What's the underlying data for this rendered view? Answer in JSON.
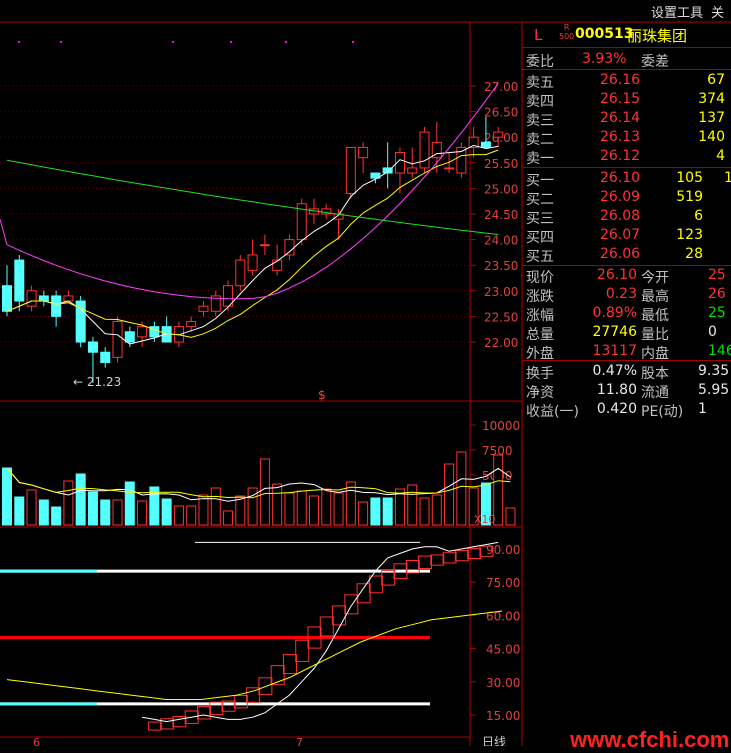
{
  "menu": {
    "settings": "设置工具",
    "more": "关"
  },
  "stock": {
    "market": "L",
    "badge_top": "R",
    "badge_bottom": "500",
    "code": "000513",
    "name": "丽珠集团"
  },
  "quote": {
    "weibi_label": "委比",
    "weibi": "3.93%",
    "weicha_label": "委差",
    "asks": [
      {
        "label": "卖五",
        "price": "26.16",
        "vol": "67"
      },
      {
        "label": "卖四",
        "price": "26.15",
        "vol": "374"
      },
      {
        "label": "卖三",
        "price": "26.14",
        "vol": "137"
      },
      {
        "label": "卖二",
        "price": "26.13",
        "vol": "140"
      },
      {
        "label": "卖一",
        "price": "26.12",
        "vol": "4"
      }
    ],
    "bids": [
      {
        "label": "买一",
        "price": "26.10",
        "vol": "105",
        "extra": "1"
      },
      {
        "label": "买二",
        "price": "26.09",
        "vol": "519"
      },
      {
        "label": "买三",
        "price": "26.08",
        "vol": "6"
      },
      {
        "label": "买四",
        "price": "26.07",
        "vol": "123"
      },
      {
        "label": "买五",
        "price": "26.06",
        "vol": "28"
      }
    ],
    "stats": [
      {
        "l1": "现价",
        "v1": "26.10",
        "l2": "今开",
        "v2": "25"
      },
      {
        "l1": "涨跌",
        "v1": "0.23",
        "l2": "最高",
        "v2": "26"
      },
      {
        "l1": "涨幅",
        "v1": "0.89%",
        "l2": "最低",
        "v2": "25"
      },
      {
        "l1": "总量",
        "v1": "27746",
        "l2": "量比",
        "v2": "0"
      },
      {
        "l1": "外盘",
        "v1": "13117",
        "l2": "内盘",
        "v2": "146"
      }
    ],
    "fund": [
      {
        "l1": "换手",
        "v1": "0.47%",
        "l2": "股本",
        "v2": "9.35"
      },
      {
        "l1": "净资",
        "v1": "11.80",
        "l2": "流通",
        "v2": "5.95"
      },
      {
        "l1": "收益(一)",
        "v1": "0.420",
        "l2": "PE(动)",
        "v2": "1"
      }
    ]
  },
  "chart_data": [
    {
      "type": "candlestick",
      "yaxis_ticks": [
        "27.00",
        "26.50",
        "26.00",
        "25.50",
        "25.00",
        "24.50",
        "24.00",
        "23.50",
        "23.00",
        "22.50",
        "22.00"
      ],
      "ylim": [
        21.0,
        27.5
      ],
      "annotation": "21.23",
      "marker": "$",
      "candles": [
        [
          23.1,
          23.5,
          22.5,
          22.6
        ],
        [
          23.6,
          23.7,
          22.6,
          22.8
        ],
        [
          22.7,
          23.1,
          22.6,
          23.0
        ],
        [
          22.9,
          23.0,
          22.7,
          22.8
        ],
        [
          22.9,
          23.0,
          22.3,
          22.5
        ],
        [
          22.8,
          23.0,
          22.9,
          22.9
        ],
        [
          22.8,
          22.9,
          21.9,
          22.0
        ],
        [
          22.0,
          22.1,
          21.2,
          21.8
        ],
        [
          21.8,
          21.9,
          21.5,
          21.6
        ],
        [
          21.7,
          22.5,
          21.6,
          22.4
        ],
        [
          22.2,
          22.3,
          21.9,
          22.0
        ],
        [
          22.1,
          22.4,
          21.9,
          22.3
        ],
        [
          22.3,
          22.4,
          22.0,
          22.1
        ],
        [
          22.3,
          22.5,
          22.0,
          22.0
        ],
        [
          22.0,
          22.4,
          21.9,
          22.3
        ],
        [
          22.3,
          22.5,
          22.2,
          22.4
        ],
        [
          22.6,
          22.8,
          22.5,
          22.7
        ],
        [
          22.6,
          23.0,
          22.5,
          22.9
        ],
        [
          22.7,
          23.2,
          22.6,
          23.1
        ],
        [
          23.1,
          23.7,
          23.0,
          23.6
        ],
        [
          23.4,
          24.0,
          23.3,
          23.7
        ],
        [
          23.9,
          24.1,
          23.7,
          23.9
        ],
        [
          23.4,
          23.9,
          23.3,
          23.6
        ],
        [
          23.7,
          24.1,
          23.6,
          24.0
        ],
        [
          24.0,
          24.8,
          23.9,
          24.7
        ],
        [
          24.5,
          24.8,
          24.3,
          24.6
        ],
        [
          24.5,
          24.7,
          24.4,
          24.6
        ],
        [
          24.4,
          24.6,
          24.0,
          24.5
        ],
        [
          24.9,
          25.8,
          24.8,
          25.8
        ],
        [
          25.6,
          25.9,
          25.3,
          25.8
        ],
        [
          25.3,
          25.3,
          25.1,
          25.2
        ],
        [
          25.4,
          25.9,
          25.0,
          25.3
        ],
        [
          25.3,
          25.8,
          24.9,
          25.7
        ],
        [
          25.3,
          25.8,
          25.2,
          25.4
        ],
        [
          25.4,
          26.2,
          25.3,
          26.1
        ],
        [
          25.6,
          26.3,
          25.3,
          25.9
        ],
        [
          25.4,
          25.7,
          25.3,
          25.4
        ],
        [
          25.3,
          25.9,
          25.2,
          25.8
        ],
        [
          25.8,
          26.2,
          25.6,
          26.0
        ],
        [
          25.9,
          26.4,
          25.8,
          25.8
        ],
        [
          26.0,
          26.2,
          25.8,
          26.1
        ]
      ]
    },
    {
      "type": "bar",
      "series_name": "volume",
      "axis_unit": "X10",
      "yaxis_ticks": [
        "10000",
        "7500",
        "5000"
      ],
      "ylim": [
        0,
        10500
      ],
      "values": [
        5700,
        2800,
        3500,
        2500,
        1800,
        4400,
        5100,
        3300,
        2500,
        2500,
        4300,
        2400,
        3800,
        2600,
        1900,
        1900,
        3000,
        3700,
        1400,
        2900,
        3700,
        6600,
        4100,
        3200,
        3400,
        2900,
        3600,
        3200,
        4300,
        2300,
        2700,
        2700,
        3600,
        4000,
        2700,
        3000,
        6100,
        7300,
        3700,
        4200,
        7000,
        1700
      ]
    },
    {
      "type": "line",
      "yaxis_ticks": [
        "90.00",
        "75.00",
        "60.00",
        "45.00",
        "30.00",
        "15.00"
      ],
      "ylim": [
        8,
        98
      ],
      "levels": [
        80,
        50,
        20
      ]
    }
  ],
  "xaxis": {
    "m6": "6",
    "m7": "7",
    "period": "日线"
  },
  "watermark": "www.cfchi.com"
}
